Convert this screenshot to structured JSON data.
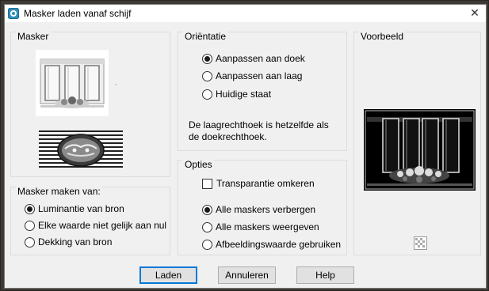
{
  "window": {
    "title": "Masker laden vanaf schijf",
    "close_symbol": "✕"
  },
  "mask_group": {
    "title": "Masker"
  },
  "mask_from_group": {
    "title": "Masker maken van:",
    "options": [
      {
        "label": "Luminantie van bron",
        "checked": true
      },
      {
        "label": "Elke waarde niet gelijk aan nul",
        "checked": false
      },
      {
        "label": "Dekking van bron",
        "checked": false
      }
    ]
  },
  "orientation_group": {
    "title": "Oriëntatie",
    "options": [
      {
        "label": "Aanpassen aan doek",
        "checked": true
      },
      {
        "label": "Aanpassen aan laag",
        "checked": false
      },
      {
        "label": "Huidige staat",
        "checked": false
      }
    ],
    "info": "De laagrechthoek is hetzelfde als de doekrechthoek."
  },
  "options_group": {
    "title": "Opties",
    "invert_label": "Transparantie omkeren",
    "invert_checked": false,
    "options": [
      {
        "label": "Alle maskers verbergen",
        "checked": true
      },
      {
        "label": "Alle maskers weergeven",
        "checked": false
      },
      {
        "label": "Afbeeldingswaarde gebruiken",
        "checked": false
      }
    ]
  },
  "preview_group": {
    "title": "Voorbeeld"
  },
  "buttons": {
    "load": "Laden",
    "cancel": "Annuleren",
    "help": "Help"
  },
  "colors": {
    "dialog_bg": "#f0f0f0",
    "default_button_border": "#0078d7",
    "preview_bg": "#000000"
  }
}
